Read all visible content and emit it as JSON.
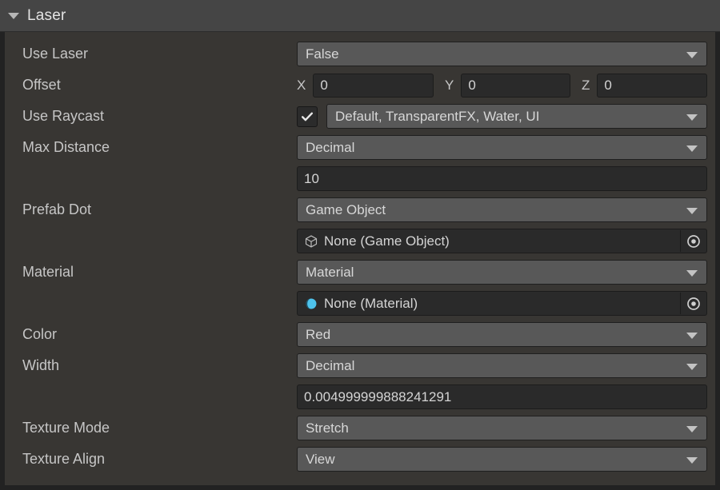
{
  "component": {
    "title": "Laser",
    "foldout_icon": "chevron-down-icon",
    "expanded": true
  },
  "colors": {
    "panel_bg": "#383633",
    "header_bg": "#454545",
    "dropdown_bg": "#585858",
    "input_bg": "#2a2a2a",
    "border": "#222222",
    "label_text": "#c6c6c6",
    "value_text": "#d7d7d7",
    "material_icon": "#4ec3ec"
  },
  "properties": {
    "use_laser": {
      "label": "Use Laser",
      "type": "dropdown",
      "value": "False"
    },
    "offset": {
      "label": "Offset",
      "type": "vector3",
      "axes": [
        {
          "axis": "X",
          "value": "0"
        },
        {
          "axis": "Y",
          "value": "0"
        },
        {
          "axis": "Z",
          "value": "0"
        }
      ]
    },
    "use_raycast": {
      "label": "Use Raycast",
      "type": "checkbox-dropdown",
      "checked": true,
      "check_icon": "checkmark-icon",
      "value": "Default, TransparentFX, Water, UI"
    },
    "max_distance": {
      "label": "Max Distance",
      "type": "dropdown-with-input",
      "mode": "Decimal",
      "value": "10"
    },
    "prefab_dot": {
      "label": "Prefab Dot",
      "type": "dropdown-with-object",
      "mode": "Game Object",
      "object_icon": "cube-icon",
      "object_value": "None (Game Object)",
      "picker_icon": "object-picker-icon"
    },
    "material": {
      "label": "Material",
      "type": "dropdown-with-object",
      "mode": "Material",
      "object_icon": "sphere-icon",
      "object_value": "None (Material)",
      "picker_icon": "object-picker-icon"
    },
    "color": {
      "label": "Color",
      "type": "dropdown",
      "value": "Red"
    },
    "width": {
      "label": "Width",
      "type": "dropdown-with-input",
      "mode": "Decimal",
      "value": "0.004999999888241291"
    },
    "texture_mode": {
      "label": "Texture Mode",
      "type": "dropdown",
      "value": "Stretch"
    },
    "texture_align": {
      "label": "Texture Align",
      "type": "dropdown",
      "value": "View"
    }
  }
}
